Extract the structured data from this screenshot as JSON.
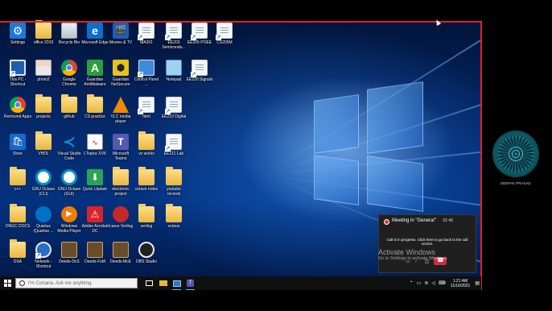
{
  "desktop": {
    "icons": [
      {
        "label": "Settings",
        "kind": "settings",
        "color": "#1e78d7"
      },
      {
        "label": "office 2019",
        "kind": "folder"
      },
      {
        "label": "Recycle Bin",
        "kind": "bin"
      },
      {
        "label": "Microsoft Edge",
        "kind": "edge",
        "color": "#0a6fd1"
      },
      {
        "label": "Movies & TV",
        "kind": "movies",
        "color": "#1b5fb5"
      },
      {
        "label": "MA201",
        "kind": "doc"
      },
      {
        "label": "EE203 Semicondu...",
        "kind": "doc"
      },
      {
        "label": "EE205 POEE",
        "kind": "doc"
      },
      {
        "label": "CS205M",
        "kind": "doc"
      },
      {
        "label": "This PC - Shortcut",
        "kind": "pc"
      },
      {
        "label": "photo2",
        "kind": "photo"
      },
      {
        "label": "Google Chrome",
        "kind": "chrome"
      },
      {
        "label": "Guardian AntiMalware",
        "kind": "guardian",
        "color": "#2e9e3a"
      },
      {
        "label": "Guardian NetSecure",
        "kind": "guardian2",
        "color": "#e8c21e"
      },
      {
        "label": "Control Panel ...",
        "kind": "control",
        "color": "#3c8ad8"
      },
      {
        "label": "Notepad",
        "kind": "notepad"
      },
      {
        "label": "EE220 Signals",
        "kind": "doc"
      },
      {
        "label": "Removed Apps",
        "kind": "chrome"
      },
      {
        "label": "projects",
        "kind": "folder"
      },
      {
        "label": "github",
        "kind": "folder"
      },
      {
        "label": "CS practice",
        "kind": "folder"
      },
      {
        "label": "VLC media player",
        "kind": "vlc"
      },
      {
        "label": "html",
        "kind": "doc"
      },
      {
        "label": "EE210 Digital",
        "kind": "doc"
      },
      {
        "label": "Store",
        "kind": "store",
        "color": "#1769c9"
      },
      {
        "label": "VHDL",
        "kind": "folder"
      },
      {
        "label": "Visual Studio Code",
        "kind": "vscode",
        "color": "#1a8ad4"
      },
      {
        "label": "LTspice XVII",
        "kind": "ltspice"
      },
      {
        "label": "Microsoft Teams",
        "kind": "teams",
        "color": "#5558af"
      },
      {
        "label": "vs works",
        "kind": "folder"
      },
      {
        "label": "EE211 Lab",
        "kind": "doc"
      },
      {
        "label": "c++",
        "kind": "folder"
      },
      {
        "label": "GNU Octave (CLI)",
        "kind": "octave"
      },
      {
        "label": "GNU Octave (GUI)",
        "kind": "octave"
      },
      {
        "label": "Quick Update",
        "kind": "quick",
        "color": "#2aa356"
      },
      {
        "label": "electronic project",
        "kind": "folder"
      },
      {
        "label": "octave notes",
        "kind": "folder"
      },
      {
        "label": "youtube records",
        "kind": "folder"
      },
      {
        "label": "ONGC DOCS",
        "kind": "folder"
      },
      {
        "label": "Quartus (Quartus ...",
        "kind": "quartus"
      },
      {
        "label": "Windows Media Player",
        "kind": "wmp"
      },
      {
        "label": "Adobe Acrobat DC",
        "kind": "acrobat",
        "color": "#d8232a"
      },
      {
        "label": "Icarus Verilog",
        "kind": "icarus",
        "color": "#c42a2a"
      },
      {
        "label": "verilog",
        "kind": "folder"
      },
      {
        "label": "octave",
        "kind": "folder"
      },
      {
        "label": "DSA",
        "kind": "folder"
      },
      {
        "label": "Network - Shortcut",
        "kind": "network"
      },
      {
        "label": "Deeds-DcS",
        "kind": "deeds"
      },
      {
        "label": "Deeds-FsM",
        "kind": "deeds"
      },
      {
        "label": "Deeds-McE",
        "kind": "deeds"
      },
      {
        "label": "OBS Studio",
        "kind": "obs"
      }
    ]
  },
  "taskbar": {
    "search_placeholder": "I'm Cortana. Ask me anything.",
    "time": "1:21 AM",
    "date": "11/10/2021"
  },
  "meeting_popup": {
    "title": "Meeting in \"General\"",
    "timer": "01:46",
    "description": "Call is in progress. Click here to go back to the call screen."
  },
  "watermark": {
    "line1": "Activate Windows",
    "line2": "Go to Settings to activate Windows."
  },
  "user_panel": {
    "name": "DEEPAK PRASAD"
  }
}
